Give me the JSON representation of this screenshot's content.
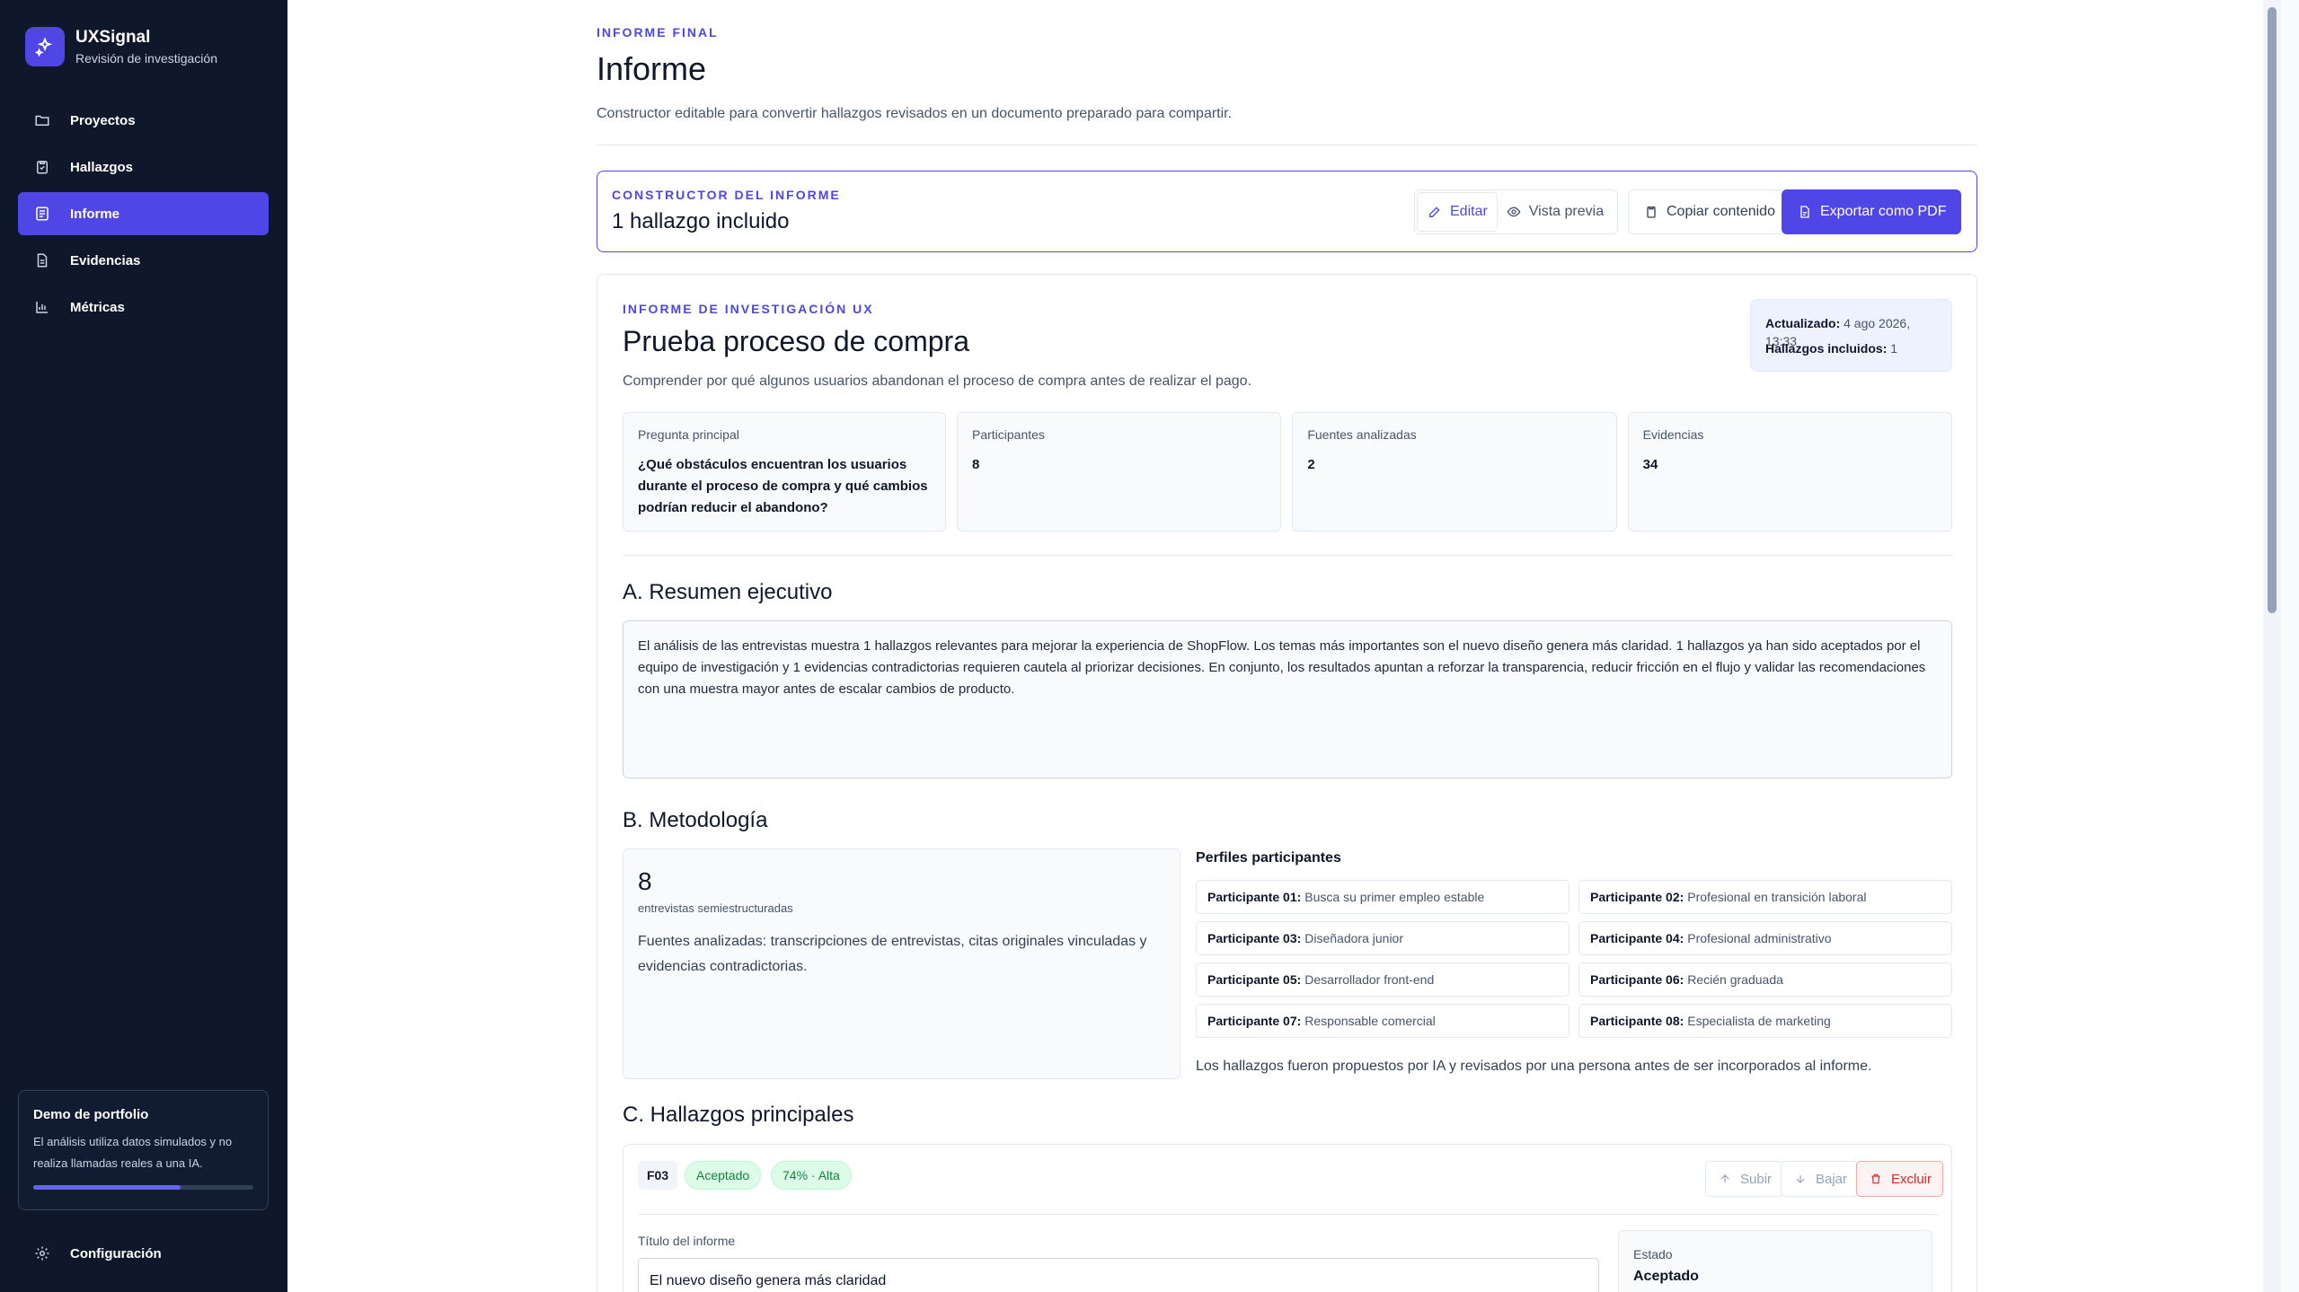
{
  "brand": {
    "name": "UXSignal",
    "subtitle": "Revisión de investigación"
  },
  "nav": [
    {
      "label": "Proyectos",
      "icon": "folder-icon",
      "active": false
    },
    {
      "label": "Hallazgos",
      "icon": "clipboard-icon",
      "active": false
    },
    {
      "label": "Informe",
      "icon": "report-icon",
      "active": true
    },
    {
      "label": "Evidencias",
      "icon": "document-icon",
      "active": false
    },
    {
      "label": "Métricas",
      "icon": "bar-chart-icon",
      "active": false
    }
  ],
  "demo": {
    "title": "Demo de portfolio",
    "text": "El análisis utiliza datos simulados y no realiza llamadas reales a una IA.",
    "progress": 0.67
  },
  "settings_label": "Configuración",
  "header": {
    "eyebrow": "INFORME FINAL",
    "title": "Informe",
    "description": "Constructor editable para convertir hallazgos revisados en un documento preparado para compartir."
  },
  "builder": {
    "eyebrow": "CONSTRUCTOR DEL INFORME",
    "title": "1 hallazgo incluido",
    "edit_label": "Editar",
    "preview_label": "Vista previa",
    "copy_label": "Copiar contenido",
    "export_label": "Exportar como PDF"
  },
  "report": {
    "eyebrow": "INFORME DE INVESTIGACIÓN UX",
    "title": "Prueba proceso de compra",
    "description": "Comprender por qué algunos usuarios abandonan el proceso de compra antes de realizar el pago.",
    "updated_label": "Actualizado:",
    "updated_value": "4 ago 2026, 13:33",
    "included_label": "Hallazgos incluidos:",
    "included_value": "1",
    "cards": [
      {
        "label": "Pregunta principal",
        "value": "¿Qué obstáculos encuentran los usuarios durante el proceso de compra y qué cambios podrían reducir el abandono?"
      },
      {
        "label": "Participantes",
        "value": "8"
      },
      {
        "label": "Fuentes analizadas",
        "value": "2"
      },
      {
        "label": "Evidencias",
        "value": "34"
      }
    ],
    "summary_title": "A. Resumen ejecutivo",
    "summary_text": "El análisis de las entrevistas muestra 1 hallazgos relevantes para mejorar la experiencia de ShopFlow. Los temas más importantes son el nuevo diseño genera más claridad. 1 hallazgos ya han sido aceptados por el equipo de investigación y 1 evidencias contradictorias requieren cautela al priorizar decisiones. En conjunto, los resultados apuntan a reforzar la transparencia, reducir fricción en el flujo y validar las recomendaciones con una muestra mayor antes de escalar cambios de producto.",
    "methodology_title": "B. Metodología",
    "methodology_count": "8",
    "methodology_sub": "entrevistas semiestructuradas",
    "methodology_desc": "Fuentes analizadas: transcripciones de entrevistas, citas originales vinculadas y evidencias contradictorias.",
    "profiles_title": "Perfiles participantes",
    "profiles": [
      {
        "name": "Participante 01:",
        "role": "Busca su primer empleo estable"
      },
      {
        "name": "Participante 02:",
        "role": "Profesional en transición laboral"
      },
      {
        "name": "Participante 03:",
        "role": "Diseñadora junior"
      },
      {
        "name": "Participante 04:",
        "role": "Profesional administrativo"
      },
      {
        "name": "Participante 05:",
        "role": "Desarrollador front-end"
      },
      {
        "name": "Participante 06:",
        "role": "Recién graduada"
      },
      {
        "name": "Participante 07:",
        "role": "Responsable comercial"
      },
      {
        "name": "Participante 08:",
        "role": "Especialista de marketing"
      }
    ],
    "methodology_note": "Los hallazgos fueron propuestos por IA y revisados por una persona antes de ser incorporados al informe.",
    "findings_title": "C. Hallazgos principales",
    "finding": {
      "id": "F03",
      "status_badge": "Aceptado",
      "confidence_badge": "74% · Alta",
      "up_label": "Subir",
      "down_label": "Bajar",
      "exclude_label": "Excluir",
      "title_label": "Título del informe",
      "title_value": "El nuevo diseño genera más claridad",
      "state_label": "Estado",
      "state_value": "Aceptado"
    }
  },
  "colors": {
    "accent": "#4f46e5",
    "sidebar": "#0f172a",
    "success": "#15803d",
    "danger": "#dc2626"
  }
}
